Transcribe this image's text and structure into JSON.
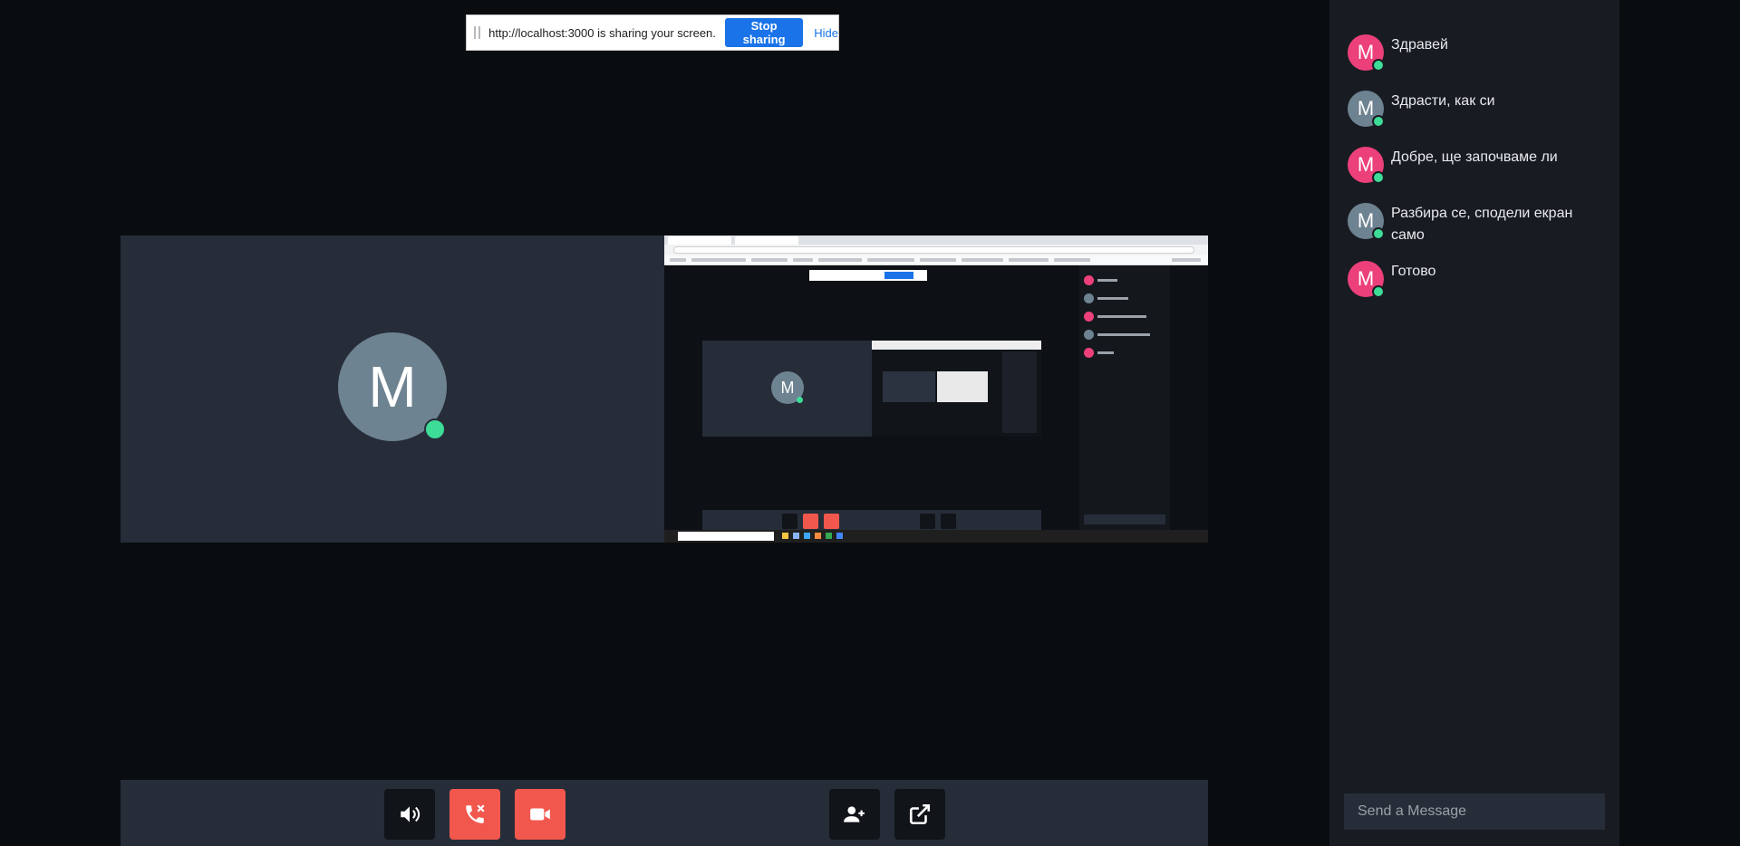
{
  "share_bar": {
    "message": "http://localhost:3000 is sharing your screen.",
    "stop_label": "Stop sharing",
    "hide_label": "Hide"
  },
  "participant": {
    "initial": "M",
    "online": true
  },
  "controls": {
    "left": [
      {
        "name": "speaker-toggle-button",
        "icon": "volume-icon",
        "color": "#111418"
      },
      {
        "name": "end-call-button",
        "icon": "phone-hangup-icon",
        "color": "#f2574e"
      },
      {
        "name": "video-toggle-button",
        "icon": "video-camera-icon",
        "color": "#f2574e"
      }
    ],
    "right": [
      {
        "name": "invite-user-button",
        "icon": "user-plus-icon",
        "color": "#111418"
      },
      {
        "name": "popout-button",
        "icon": "external-link-icon",
        "color": "#111418"
      }
    ]
  },
  "chat": {
    "messages": [
      {
        "initial": "M",
        "avatar_color": "#ec407a",
        "text": "Здравей"
      },
      {
        "initial": "M",
        "avatar_color": "#6e8391",
        "text": "Здрасти, как си"
      },
      {
        "initial": "M",
        "avatar_color": "#ec407a",
        "text": "Добре, ще започваме ли"
      },
      {
        "initial": "M",
        "avatar_color": "#6e8391",
        "text": "Разбира се, сподели екран само"
      },
      {
        "initial": "M",
        "avatar_color": "#ec407a",
        "text": "Готово"
      }
    ],
    "input_placeholder": "Send a Message"
  },
  "colors": {
    "background": "#0a0d10",
    "tile": "#262d39",
    "online": "#3ddc97",
    "danger": "#f2574e",
    "accent": "#1a73e8"
  }
}
